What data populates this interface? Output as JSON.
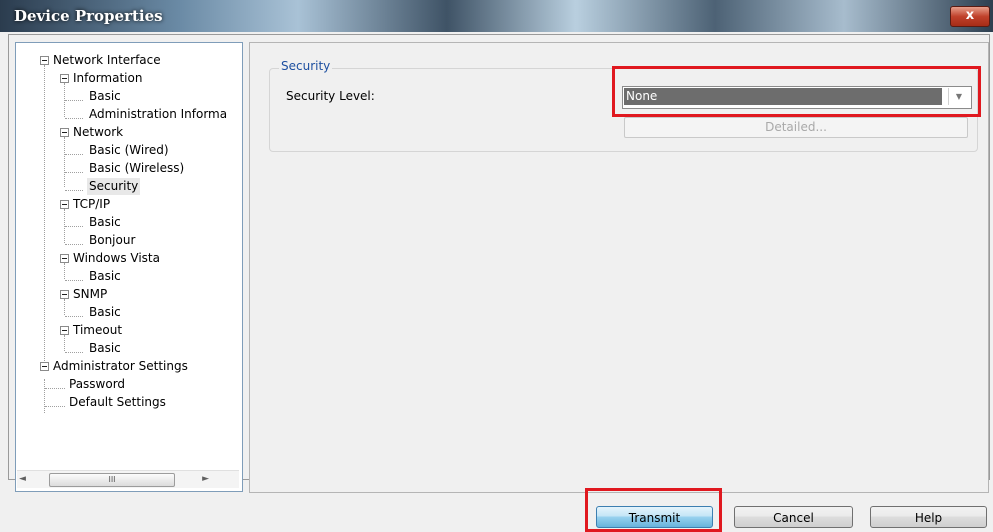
{
  "window": {
    "title": "Device Properties",
    "close_label": "x"
  },
  "tree": {
    "nodes": [
      "Network Interface",
      "Information",
      "Basic",
      "Administration Informa",
      "Network",
      "Basic (Wired)",
      "Basic (Wireless)",
      "Security",
      "TCP/IP",
      "Basic",
      "Bonjour",
      "Windows Vista",
      "Basic",
      "SNMP",
      "Basic",
      "Timeout",
      "Basic",
      "Administrator Settings",
      "Password",
      "Default Settings"
    ],
    "selected": "Security",
    "scroll_left_icon": "◄",
    "scroll_right_icon": "►",
    "scroll_thumb_grip": "III"
  },
  "security": {
    "group_label": "Security",
    "level_label": "Security Level:",
    "level_value": "None",
    "dropdown_icon": "chevron-down-icon",
    "detailed_label": "Detailed..."
  },
  "buttons": {
    "transmit": "Transmit",
    "cancel": "Cancel",
    "help": "Help"
  },
  "colors": {
    "highlight": "#e0181f",
    "group_label": "#1d4fa0"
  }
}
